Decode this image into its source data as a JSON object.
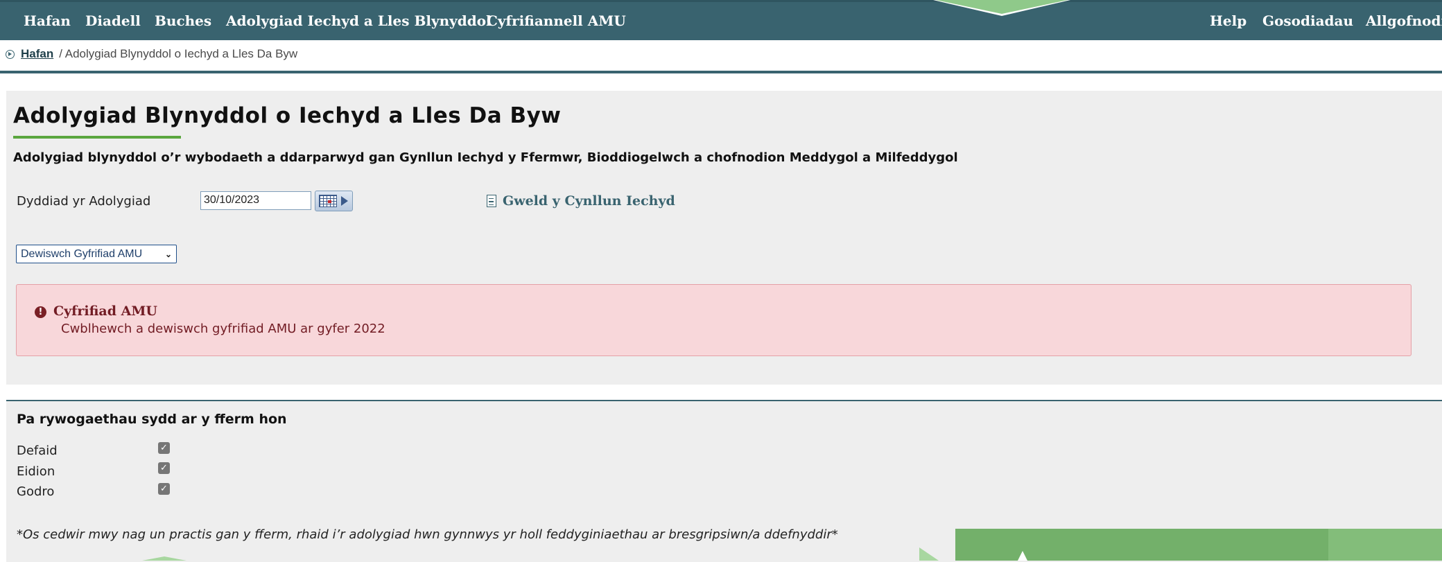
{
  "topnav": {
    "left_items": [
      "Hafan",
      "Diadell",
      "Buches",
      "Adolygiad Iechyd a Lles Blynyddol",
      "Cyfrifiannell AMU"
    ],
    "right_items": [
      "Help",
      "Gosodiadau",
      "Allgofnodi"
    ]
  },
  "breadcrumb": {
    "home": "Hafan",
    "current": "/ Adolygiad Blynyddol o Iechyd a Lles Da Byw"
  },
  "page": {
    "title": "Adolygiad Blynyddol o Iechyd a Lles Da Byw",
    "subtitle": "Adolygiad blynyddol o’r wybodaeth a ddarparwyd gan Gynllun Iechyd y Ffermwr, Bioddiogelwch a chofnodion Meddygol a Milfeddygol"
  },
  "review": {
    "date_label": "Dyddiad yr Adolygiad",
    "date_value": "30/10/2023",
    "plan_link": "Gweld y Cynllun Iechyd"
  },
  "amu_select": {
    "selected": "Dewiswch Gyfrifiad AMU"
  },
  "alert": {
    "title": "Cyfrifiad AMU",
    "message": "Cwblhewch a dewiswch gyfrifiad AMU ar gyfer 2022",
    "color": "#f8d7da"
  },
  "species": {
    "question": "Pa rywogaethau sydd ar y fferm hon",
    "items": [
      {
        "label": "Defaid",
        "checked": true
      },
      {
        "label": "Eidion",
        "checked": true
      },
      {
        "label": "Godro",
        "checked": true
      }
    ],
    "note": "*Os cedwir mwy nag un practis gan y fferm, rhaid i’r adolygiad hwn gynnwys yr holl feddyginiaethau ar bresgripsiwn/a ddefnyddir*"
  },
  "colors": {
    "nav": "#39636f",
    "accent": "#5aa63e",
    "panel": "#eeeeee"
  },
  "icons": [
    "breadcrumb-arrow-icon",
    "calendar-icon",
    "document-icon",
    "exclamation-circle-icon",
    "checkmark-icon"
  ]
}
